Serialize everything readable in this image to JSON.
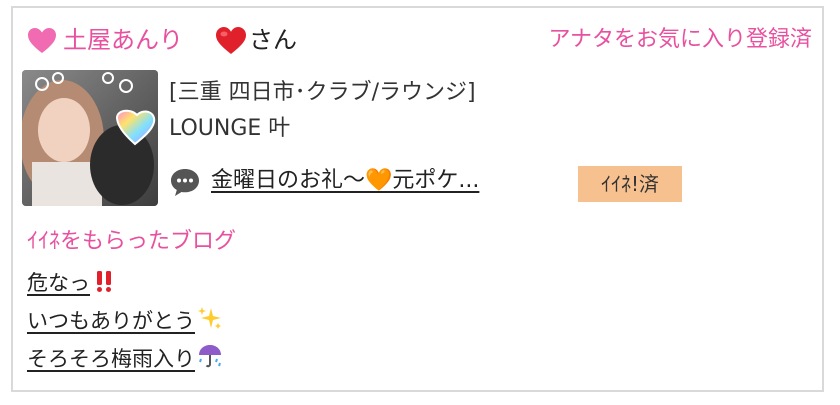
{
  "header": {
    "girl_name": "土屋あんり",
    "honorific": "さん",
    "favorite_status": "アナタをお気に入り登録済"
  },
  "profile": {
    "category": "[三重 四日市･クラブ/ラウンジ]",
    "shop_name": "LOUNGE 叶",
    "latest_blog_title": "金曜日のお礼〜🧡元ポケ...",
    "iine_badge": "ｲｲﾈ!済"
  },
  "liked_blogs": {
    "heading": "ｲｲﾈをもらったブログ",
    "items": [
      {
        "title": "危なっ"
      },
      {
        "title": "いつもありがとう"
      },
      {
        "title": "そろそろ梅雨入り"
      }
    ]
  },
  "colors": {
    "accent_pink": "#e8519f",
    "badge_orange": "#f7c18f",
    "border_gray": "#d9d9d9"
  },
  "icons": [
    "pink-heart-icon",
    "red-heart-icon",
    "chat-bubble-icon",
    "double-exclamation-icon",
    "sparkles-icon",
    "umbrella-rain-icon"
  ]
}
